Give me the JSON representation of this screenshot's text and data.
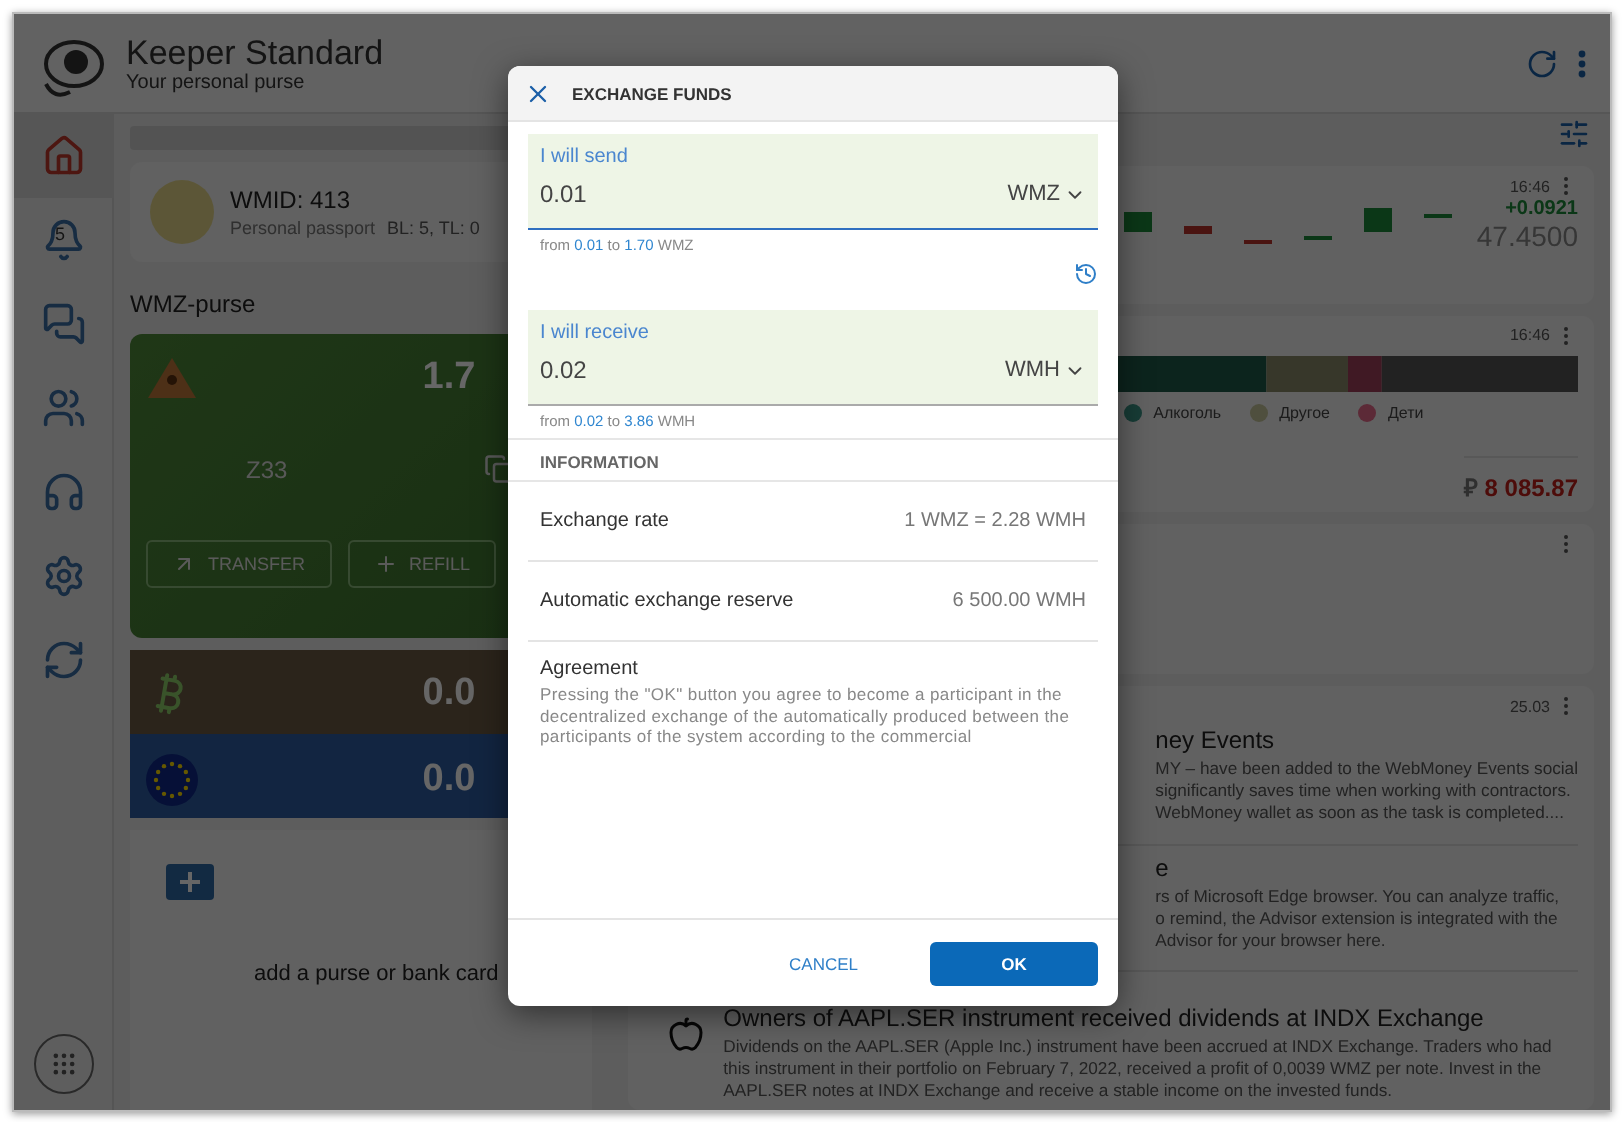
{
  "app": {
    "title": "Keeper Standard",
    "subtitle": "Your personal purse"
  },
  "sidebar": {
    "items": [
      {
        "selected": true
      },
      {
        "selected": false,
        "badge": "5"
      },
      {
        "selected": false
      },
      {
        "selected": false
      },
      {
        "selected": false
      },
      {
        "selected": false
      },
      {
        "selected": false
      }
    ]
  },
  "passport": {
    "wmid": "WMID: 413",
    "type": "Personal passport",
    "levels": "BL: 5, TL: 0"
  },
  "purse_title": "WMZ-purse",
  "purses": [
    {
      "kind": "wmz",
      "amount": "1.7",
      "number": "Z33",
      "actions": [
        "TRANSFER",
        "REFILL"
      ]
    },
    {
      "kind": "bitcoin",
      "amount": "0.0"
    },
    {
      "kind": "euro",
      "amount": "0.0"
    }
  ],
  "add_purse": "add a purse or bank card",
  "rates_card": {
    "time": "16:46",
    "change": "+0.0921",
    "price": "47.4500"
  },
  "budget_card": {
    "time": "16:46",
    "legend": [
      {
        "label": "Алкоголь",
        "color": "#173c36"
      },
      {
        "label": "Другое",
        "color": "#4f4f3e"
      },
      {
        "label": "Дети",
        "color": "#5c2a37"
      }
    ],
    "currency": "₽",
    "total": "8 085.87"
  },
  "news": {
    "date": "25.03",
    "items": [
      {
        "kind": "covered",
        "title": "ney Events",
        "lines": [
          "MY – have been added to the WebMoney Events social",
          "significantly saves time when working with contractors.",
          "WebMoney wallet as soon as the task is completed...."
        ]
      },
      {
        "kind": "covered",
        "title": "e",
        "lines": [
          "rs of Microsoft Edge browser. You can analyze traffic,",
          "o remind, the Advisor extension is integrated with the",
          "Advisor for your browser here."
        ]
      },
      {
        "kind": "full",
        "title": "Owners of AAPL.SER instrument received dividends at INDX Exchange",
        "lines": [
          "Dividends on the AAPL.SER (Apple Inc.) instrument have been accrued at INDX Exchange. Traders who had",
          "this instrument in their portfolio on February 7, 2022, received a profit of 0,0039 WMZ per note. Invest in the",
          "AAPL.SER notes at INDX Exchange and receive a stable income on the invested funds."
        ]
      }
    ]
  },
  "dialog": {
    "title": "EXCHANGE FUNDS",
    "fields": [
      {
        "label": "I will send",
        "value": "0.01",
        "currency": "WMZ",
        "focused": true,
        "hint": [
          {
            "text": "from",
            "highlight": false
          },
          {
            "text": "0.01",
            "highlight": true
          },
          {
            "text": "to",
            "highlight": false
          },
          {
            "text": "1.70",
            "highlight": true
          },
          {
            "text": "WMZ",
            "highlight": false
          }
        ]
      },
      {
        "label": "I will receive",
        "value": "0.02",
        "currency": "WMH",
        "focused": false,
        "hint": [
          {
            "text": "from",
            "highlight": false
          },
          {
            "text": "0.02",
            "highlight": true
          },
          {
            "text": "to",
            "highlight": false
          },
          {
            "text": "3.86",
            "highlight": true
          },
          {
            "text": "WMH",
            "highlight": false
          }
        ]
      }
    ],
    "section": "INFORMATION",
    "rows": [
      {
        "label": "Exchange rate",
        "value": "1 WMZ = 2.28 WMH"
      },
      {
        "label": "Automatic exchange reserve",
        "value": "6 500.00 WMH"
      }
    ],
    "agreement_title": "Agreement",
    "agreement_text": "Pressing the \"OK\" button you agree to become a participant in the decentralized exchange of the automatically produced between the participants of the system according to the commercial",
    "buttons": [
      "CANCEL",
      "OK"
    ]
  }
}
